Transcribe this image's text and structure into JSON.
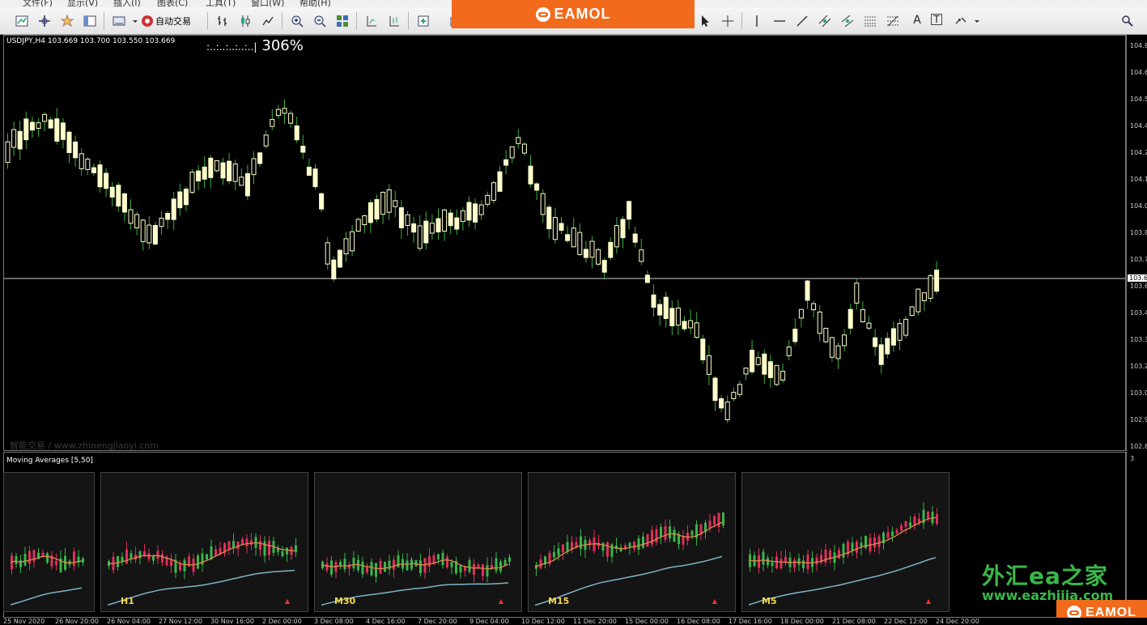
{
  "menu": [
    "文件(F)",
    "显示(V)",
    "插入(I)",
    "图表(C)",
    "工具(T)",
    "窗口(W)",
    "帮助(H)"
  ],
  "toolbar": {
    "autotrade_label": "自动交易",
    "font_text_icon": "A",
    "text_box_icon": "T"
  },
  "banner_top": "EAMOL",
  "banner_bottom": "EAMOL",
  "chart": {
    "symbol_line": "USDJPY,H4  103.669 103.700 103.550 103.669",
    "zoom_dots": ":..:..:..:..:..|",
    "zoom": "306%",
    "watermark": "智能交易 / www.zhinengjiaoyi.com",
    "indicator_title": "Moving Averages [5,50]",
    "current_price_label": "103.6",
    "price_ticks": [
      "104.8",
      "104.6",
      "104.5",
      "104.4",
      "104.2",
      "104.1",
      "104.0",
      "103.8",
      "103.7",
      "103.6",
      "103.4",
      "103.3",
      "103.2",
      "103.0",
      "102.9",
      "102.8"
    ],
    "sub_axis_label": "3"
  },
  "panels": [
    {
      "label": ""
    },
    {
      "label": "H1"
    },
    {
      "label": "M30"
    },
    {
      "label": "M15"
    },
    {
      "label": "M5"
    }
  ],
  "time_ticks": [
    "25 Nov 2020",
    "26 Nov 20:00",
    "26 Nov 04:00",
    "27 Nov 12:00",
    "30 Nov 16:00",
    "2 Dec 00:00",
    "3 Dec 08:00",
    "4 Dec 16:00",
    "7 Dec 20:00",
    "9 Dec 04:00",
    "10 Dec 12:00",
    "11 Dec 20:00",
    "15 Dec 00:00",
    "16 Dec 08:00",
    "17 Dec 16:00",
    "18 Dec 00:00",
    "21 Dec 08:00",
    "22 Dec 12:00",
    "24 Dec 20:00"
  ],
  "brand": {
    "cn": "外汇ea之家",
    "url": "www.eazhijia.com"
  },
  "colors": {
    "bull": "#ffffcc",
    "bear": "#ffffcc",
    "wick": "#3cb043",
    "ma_fast": "#d98c4c",
    "ma_slow": "#7fb3c8",
    "up_candle": "#39b54a",
    "down_candle": "#e0305a"
  }
}
